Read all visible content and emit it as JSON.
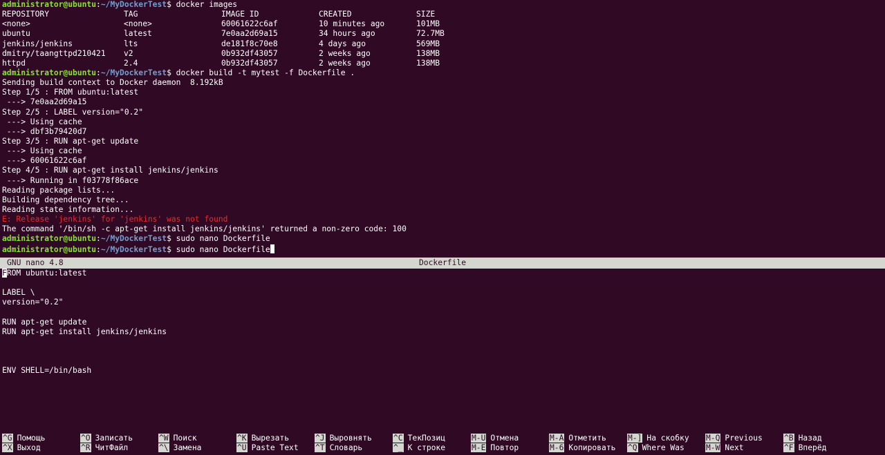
{
  "terminal": {
    "prompt_user": "administrator@ubuntu",
    "prompt_sep": ":",
    "prompt_path": "~/MyDockerTest",
    "prompt_dollar": "$",
    "cmd_images": " docker images",
    "images_headers": [
      "REPOSITORY",
      "TAG",
      "IMAGE ID",
      "CREATED",
      "SIZE"
    ],
    "images_rows": [
      [
        "<none>",
        "<none>",
        "60061622c6af",
        "10 minutes ago",
        "101MB"
      ],
      [
        "ubuntu",
        "latest",
        "7e0aa2d69a15",
        "34 hours ago",
        "72.7MB"
      ],
      [
        "jenkins/jenkins",
        "lts",
        "de181f8c70e8",
        "4 days ago",
        "569MB"
      ],
      [
        "dmitry/taangttpd210421",
        "v2",
        "0b932df43057",
        "2 weeks ago",
        "138MB"
      ],
      [
        "httpd",
        "2.4",
        "0b932df43057",
        "2 weeks ago",
        "138MB"
      ]
    ],
    "cmd_build": " docker build -t mytest -f Dockerfile .",
    "build_output": [
      "Sending build context to Docker daemon  8.192kB",
      "Step 1/5 : FROM ubuntu:latest",
      " ---> 7e0aa2d69a15",
      "Step 2/5 : LABEL version=\"0.2\"",
      " ---> Using cache",
      " ---> dbf3b79420d7",
      "Step 3/5 : RUN apt-get update",
      " ---> Using cache",
      " ---> 60061622c6af",
      "Step 4/5 : RUN apt-get install jenkins/jenkins",
      " ---> Running in f03778f86ace",
      "Reading package lists...",
      "Building dependency tree...",
      "Reading state information..."
    ],
    "error_line": "E: Release 'jenkins' for 'jenkins' was not found",
    "result_line": "The command '/bin/sh -c apt-get install jenkins/jenkins' returned a non-zero code: 100",
    "cmd_nano_1": " sudo nano Dockerfile",
    "cmd_nano_2": " sudo nano Dockerfile"
  },
  "nano": {
    "version": "GNU nano 4.8",
    "filename": "Dockerfile",
    "cursor_char": "F",
    "first_line_rest": "ROM ubuntu:latest",
    "lines": [
      "",
      "LABEL \\",
      "version=\"0.2\"",
      "",
      "RUN apt-get update",
      "RUN apt-get install jenkins/jenkins",
      "",
      "",
      "",
      "ENV SHELL=/bin/bash"
    ],
    "shortcuts_row1": [
      {
        "key": "^G",
        "label": "Помощь"
      },
      {
        "key": "^O",
        "label": "Записать"
      },
      {
        "key": "^W",
        "label": "Поиск"
      },
      {
        "key": "^K",
        "label": "Вырезать"
      },
      {
        "key": "^J",
        "label": "Выровнять"
      },
      {
        "key": "^C",
        "label": "ТекПозиц"
      },
      {
        "key": "M-U",
        "label": "Отмена"
      },
      {
        "key": "M-A",
        "label": "Отметить"
      },
      {
        "key": "M-]",
        "label": "На скобку"
      },
      {
        "key": "M-Q",
        "label": "Previous"
      },
      {
        "key": "^B",
        "label": "Назад"
      }
    ],
    "shortcuts_row2": [
      {
        "key": "^X",
        "label": "Выход"
      },
      {
        "key": "^R",
        "label": "ЧитФайл"
      },
      {
        "key": "^\\",
        "label": "Замена"
      },
      {
        "key": "^U",
        "label": "Paste Text"
      },
      {
        "key": "^T",
        "label": "Словарь"
      },
      {
        "key": "^_",
        "label": "К строке"
      },
      {
        "key": "M-E",
        "label": "Повтор"
      },
      {
        "key": "M-6",
        "label": "Копировать"
      },
      {
        "key": "^Q",
        "label": "Where Was"
      },
      {
        "key": "M-W",
        "label": "Next"
      },
      {
        "key": "^F",
        "label": "Вперёд"
      }
    ]
  }
}
